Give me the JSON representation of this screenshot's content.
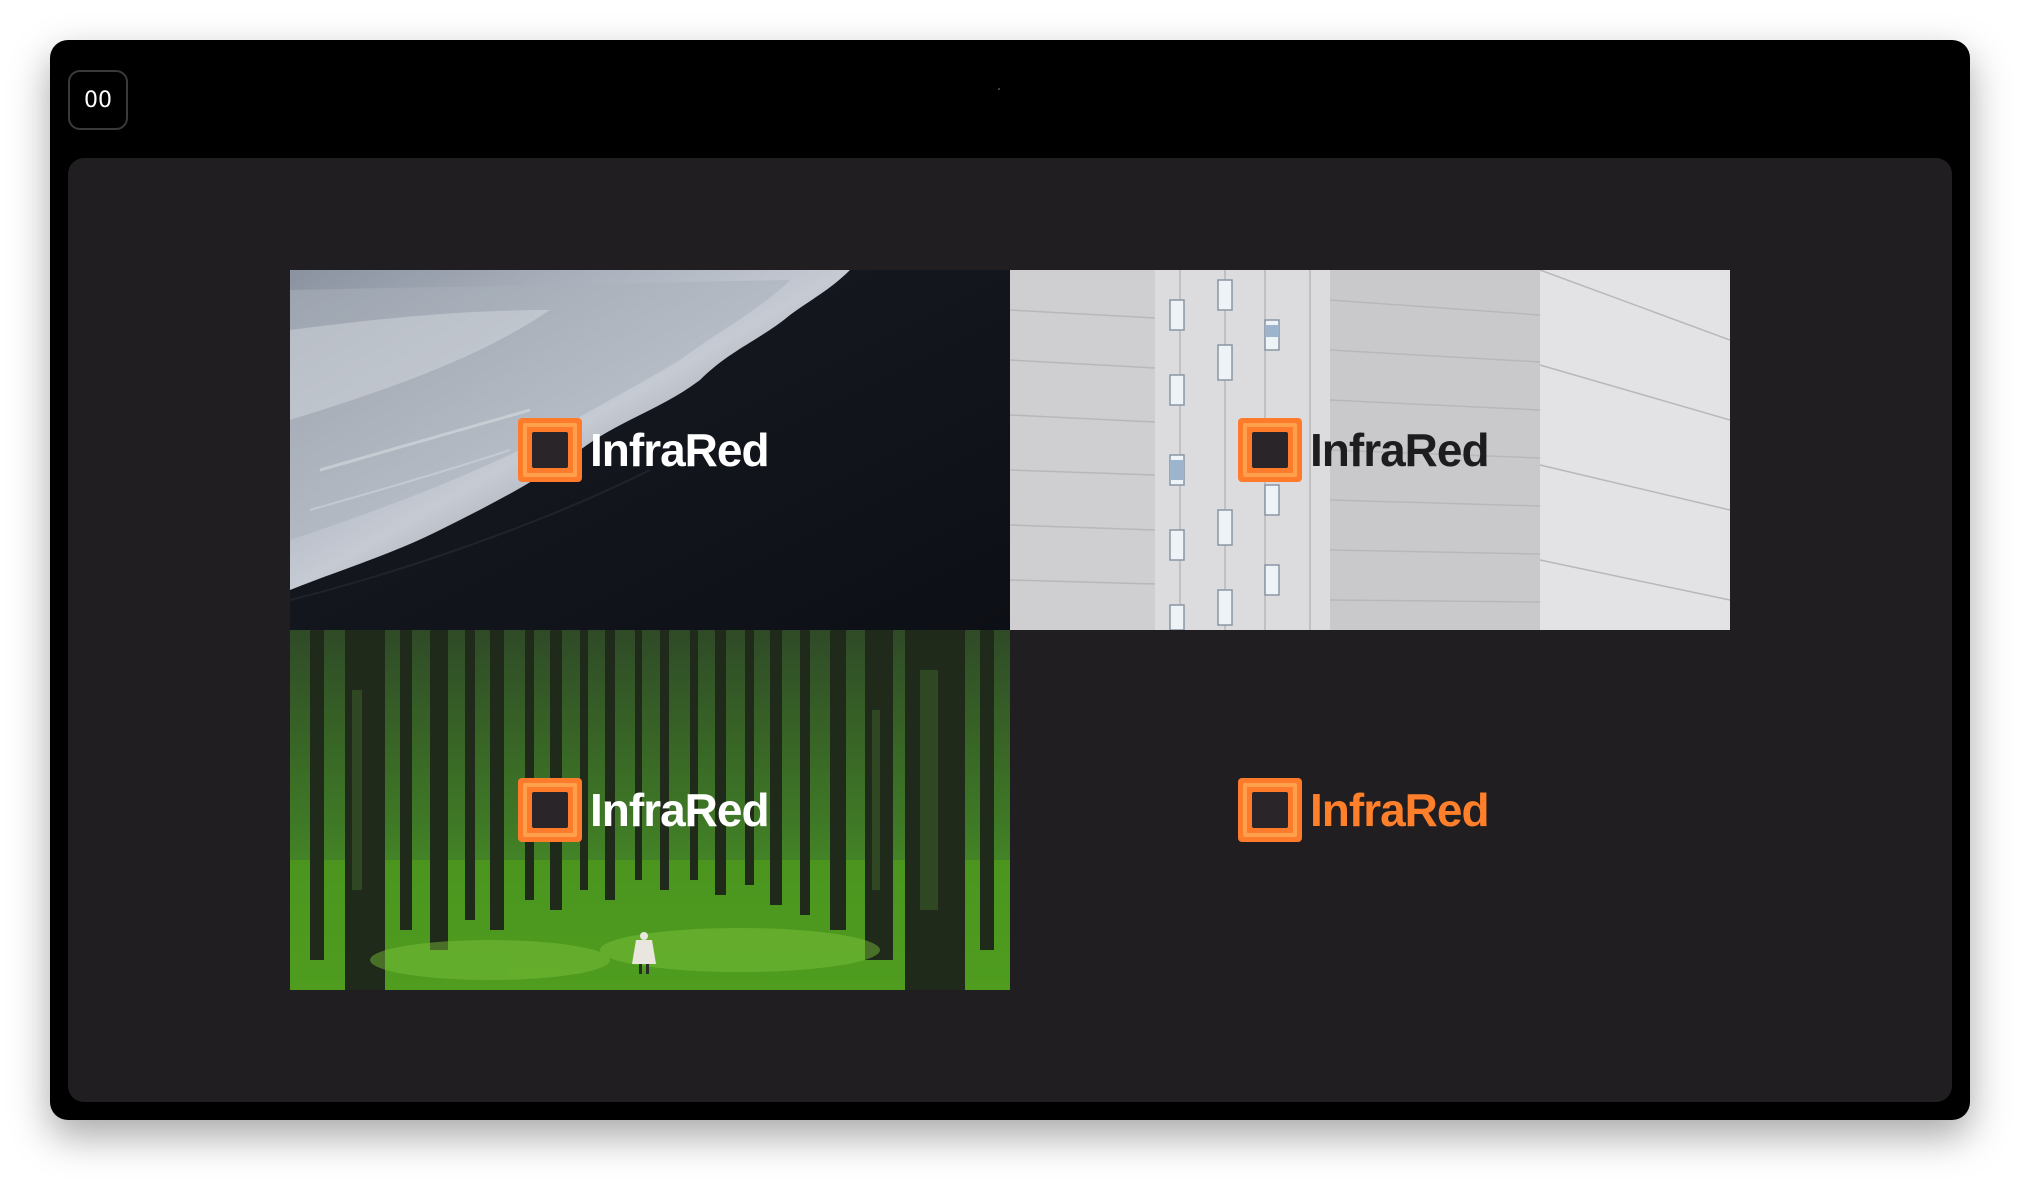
{
  "slide_counter": "00",
  "brand": {
    "name": "InfraRed",
    "colors": {
      "orange": "#ff7b2c",
      "orange_light": "#ffa04d",
      "core": "#2a2528",
      "stage": "#201e21"
    }
  },
  "tiles": [
    {
      "background": "ocean-shore-photo",
      "wordmark_color": "#ffffff"
    },
    {
      "background": "white-building-photo",
      "wordmark_color": "#1d1d1f"
    },
    {
      "background": "forest-photo",
      "wordmark_color": "#ffffff"
    },
    {
      "background": "solid-dark",
      "wordmark_color": "#ff7f2a"
    }
  ]
}
